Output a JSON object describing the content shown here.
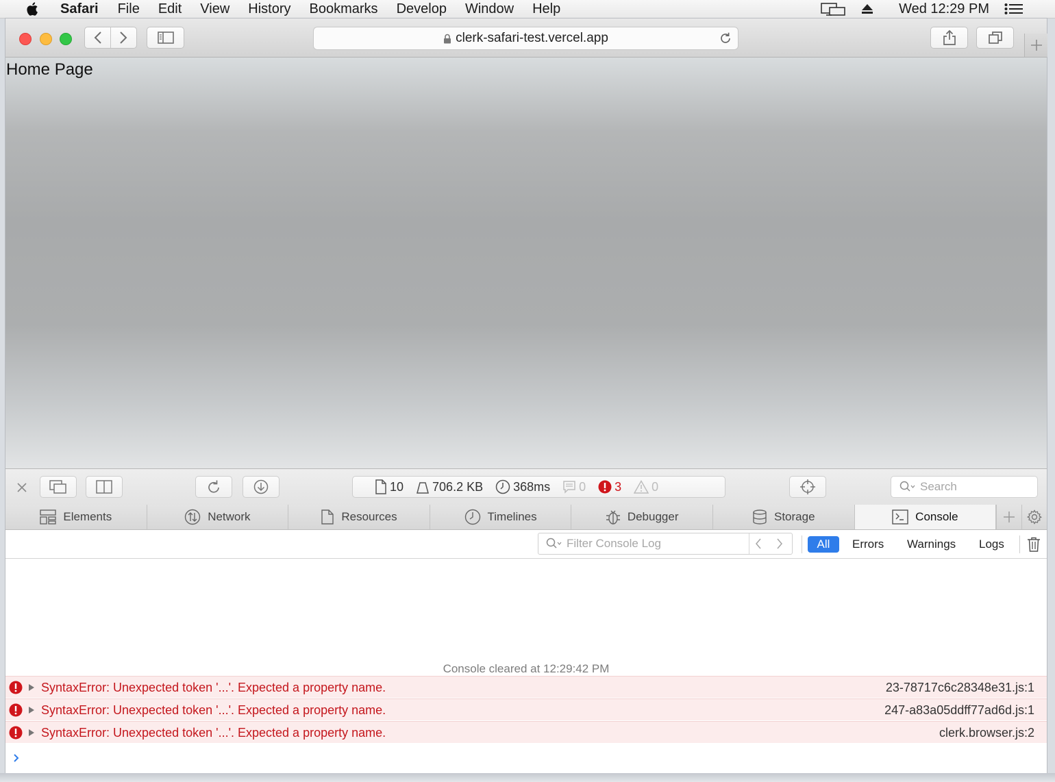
{
  "menubar": {
    "apple_icon": "apple-logo-icon",
    "app_name": "Safari",
    "items": [
      "File",
      "Edit",
      "View",
      "History",
      "Bookmarks",
      "Develop",
      "Window",
      "Help"
    ],
    "clock": "Wed 12:29 PM",
    "status_icons": [
      "display-mirroring-icon",
      "eject-icon",
      "notification-list-icon"
    ]
  },
  "browser": {
    "url": "clerk-safari-test.vercel.app",
    "page_title_text": "Home Page"
  },
  "devtools": {
    "stats": {
      "resources": "10",
      "size": "706.2 KB",
      "time": "368ms",
      "logs": "0",
      "errors": "3",
      "warnings": "0"
    },
    "search_placeholder": "Search",
    "tabs": [
      {
        "label": "Elements",
        "icon": "elements-icon"
      },
      {
        "label": "Network",
        "icon": "network-icon"
      },
      {
        "label": "Resources",
        "icon": "resources-icon"
      },
      {
        "label": "Timelines",
        "icon": "timelines-icon"
      },
      {
        "label": "Debugger",
        "icon": "debugger-icon"
      },
      {
        "label": "Storage",
        "icon": "storage-icon"
      },
      {
        "label": "Console",
        "icon": "console-icon",
        "active": true
      }
    ],
    "console": {
      "filter_placeholder": "Filter Console Log",
      "levels": {
        "all": "All",
        "errors": "Errors",
        "warnings": "Warnings",
        "logs": "Logs"
      },
      "active_level": "All",
      "cleared_message": "Console cleared at 12:29:42 PM",
      "messages": [
        {
          "text": "SyntaxError: Unexpected token '...'. Expected a property name.",
          "source": "23-78717c6c28348e31.js:1",
          "level": "error"
        },
        {
          "text": "SyntaxError: Unexpected token '...'. Expected a property name.",
          "source": "247-a83a05ddff77ad6d.js:1",
          "level": "error"
        },
        {
          "text": "SyntaxError: Unexpected token '...'. Expected a property name.",
          "source": "clerk.browser.js:2",
          "level": "error"
        }
      ]
    }
  },
  "colors": {
    "error_red": "#d0161c",
    "error_row_bg": "#fcecec",
    "accent_blue": "#2f7dea",
    "traffic_red": "#fc5753",
    "traffic_yellow": "#fdbc40",
    "traffic_green": "#33c748"
  }
}
